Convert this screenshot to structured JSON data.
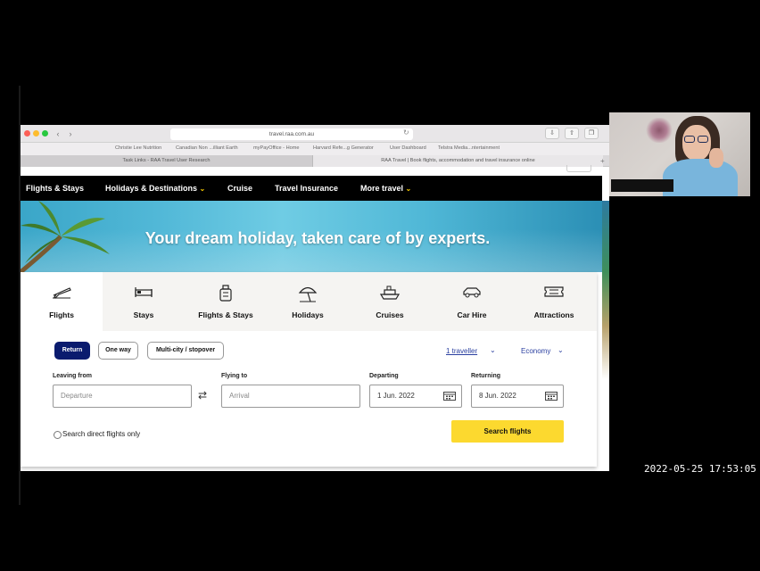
{
  "browser": {
    "url": "travel.raa.com.au",
    "bookmarks": [
      "Christie Lee Nutrition",
      "Canadian Non ...illiant Earth",
      "myPayOffice - Home",
      "Harvard Refe...g Generator",
      "User Dashboard",
      "Telstra Media...ntertainment"
    ],
    "tabs": [
      {
        "title": "Task Links - RAA Travel User Research"
      },
      {
        "title": "RAA Travel | Book flights, accommodation and travel insurance online"
      }
    ]
  },
  "site_nav": {
    "items": [
      {
        "label": "Flights & Stays"
      },
      {
        "label": "Holidays & Destinations"
      },
      {
        "label": "Cruise"
      },
      {
        "label": "Travel Insurance"
      },
      {
        "label": "More travel"
      }
    ]
  },
  "hero": {
    "title": "Your dream holiday, taken care of by experts."
  },
  "product_tabs": [
    {
      "label": "Flights",
      "icon": "plane-icon",
      "active": true
    },
    {
      "label": "Stays",
      "icon": "bed-icon"
    },
    {
      "label": "Flights & Stays",
      "icon": "luggage-icon"
    },
    {
      "label": "Holidays",
      "icon": "beach-umbrella-icon"
    },
    {
      "label": "Cruises",
      "icon": "ship-icon"
    },
    {
      "label": "Car Hire",
      "icon": "car-icon"
    },
    {
      "label": "Attractions",
      "icon": "ticket-icon"
    }
  ],
  "trip_types": [
    {
      "label": "Return",
      "selected": true
    },
    {
      "label": "One way"
    },
    {
      "label": "Multi-city / stopover"
    }
  ],
  "travellers": "1 traveller",
  "cabin_class": "Economy",
  "form": {
    "from_label": "Leaving from",
    "from_placeholder": "Departure",
    "to_label": "Flying to",
    "to_placeholder": "Arrival",
    "depart_label": "Departing",
    "depart_value": "1 Jun. 2022",
    "return_label": "Returning",
    "return_value": "8 Jun. 2022",
    "direct_only_label": "Search direct flights only",
    "search_button": "Search flights"
  },
  "colors": {
    "nav_bg": "#000000",
    "primary_button": "#fcd92f",
    "selected_pill": "#0a1b6e",
    "link": "#2a3fa0"
  },
  "recording_timestamp": "2022-05-25  17:53:05"
}
